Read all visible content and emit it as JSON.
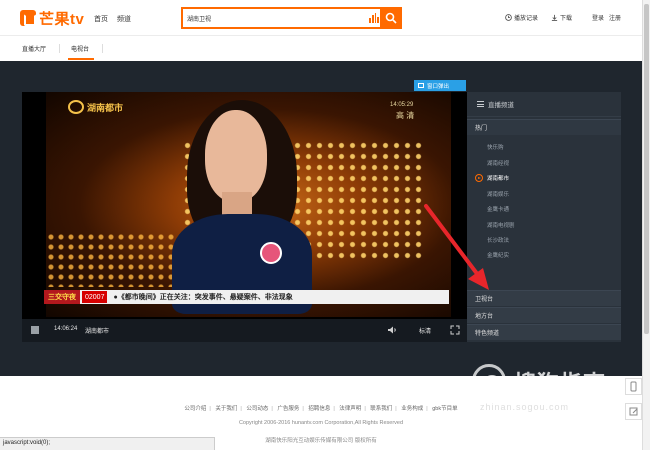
{
  "header": {
    "logo_text": "芒果tv",
    "nav": [
      "首页",
      "频道"
    ],
    "search_value": "湖南卫视",
    "history_label": "播放记录",
    "download_label": "下载",
    "login_label": "登录",
    "register_label": "注册"
  },
  "subnav": {
    "items": [
      "直播大厅",
      "电视台"
    ],
    "active": "电视台"
  },
  "player": {
    "popout_label": "窗口弹出",
    "station_logo": "湖南都市",
    "clock": "14:05:29",
    "quality_overlay": "高 清",
    "ticker_tag": "三交守夜",
    "ticker_id": "02007",
    "ticker_text": "●《都市晚间》正在关注：突发事件、悬疑案件、非法现象",
    "time": "14:06:24",
    "channel_name": "湖南都市",
    "quality_button": "标清"
  },
  "channels": {
    "panel_title": "直播频道",
    "hot_label": "热门",
    "list": [
      "快乐购",
      "湖南经视",
      "湖南都市",
      "湖南娱乐",
      "金鹰卡通",
      "湖南电视剧",
      "长沙政法",
      "金鹰纪实"
    ],
    "active": "湖南都市",
    "categories": [
      "卫视台",
      "地方台",
      "特色频道"
    ]
  },
  "footer": {
    "links": [
      "公司介绍",
      "关于我们",
      "公司动态",
      "广告服务",
      "招聘信息",
      "法律声明",
      "联系我们",
      "业务构成",
      "gbk节目单"
    ],
    "copyright": "Copyright 2006-2016 hunantv.com Corporation,All Rights Reserved",
    "company": "湖南快乐阳光互动娱乐传媒有限公司 版权所有"
  },
  "status_bar": "javascript:void(0);",
  "watermark": {
    "text": "搜狗指南",
    "sub": "zhinan.sogou.com"
  },
  "colors": {
    "brand": "#ff6a00",
    "stage": "#1f262e",
    "panel": "#2a323b",
    "popout": "#2aa0e6",
    "annotation_arrow": "#e8262b"
  }
}
